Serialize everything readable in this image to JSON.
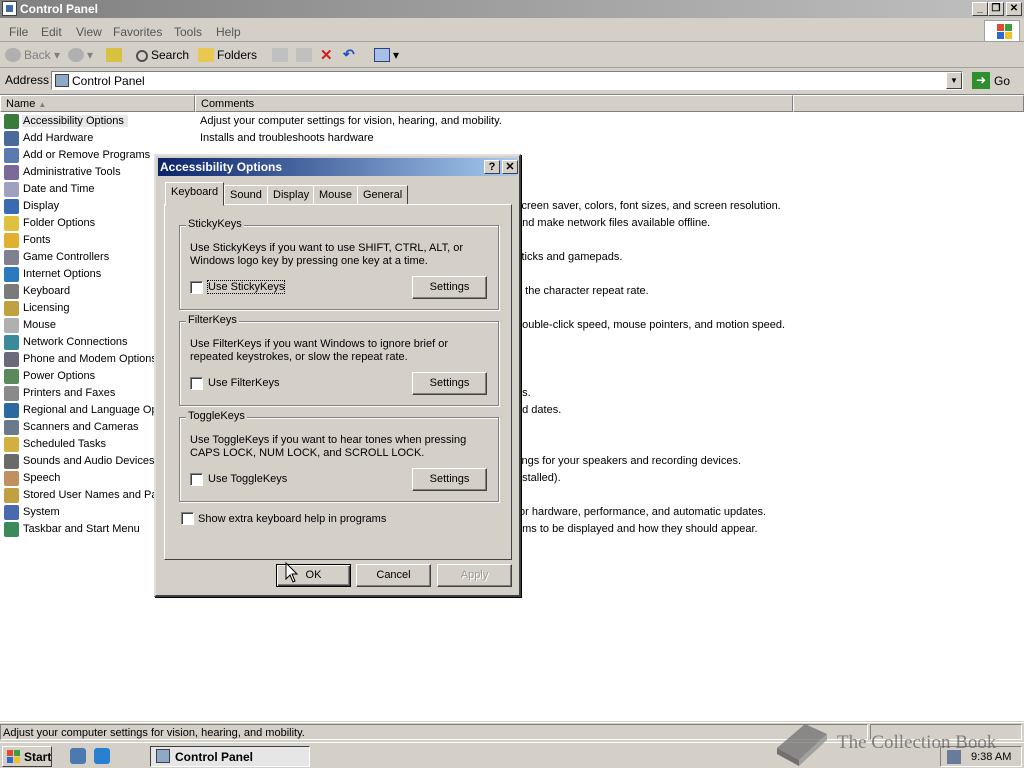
{
  "window": {
    "title": "Control Panel"
  },
  "menubar": [
    "File",
    "Edit",
    "View",
    "Favorites",
    "Tools",
    "Help"
  ],
  "toolbar": {
    "back": "Back",
    "search": "Search",
    "folders": "Folders"
  },
  "address": {
    "label": "Address",
    "value": "Control Panel",
    "go": "Go"
  },
  "columns": {
    "name": "Name",
    "comments": "Comments"
  },
  "items": [
    {
      "name": "Accessibility Options",
      "icon": "accessibility-icon",
      "color": "#3a7a3a"
    },
    {
      "name": "Add Hardware",
      "icon": "add-hardware-icon",
      "color": "#4a6a9a"
    },
    {
      "name": "Add or Remove Programs",
      "icon": "add-remove-programs-icon",
      "color": "#5a7ab0"
    },
    {
      "name": "Administrative Tools",
      "icon": "admin-tools-icon",
      "color": "#7a6a9a"
    },
    {
      "name": "Date and Time",
      "icon": "date-time-icon",
      "color": "#a0a0c0"
    },
    {
      "name": "Display",
      "icon": "display-icon",
      "color": "#3a6ab0"
    },
    {
      "name": "Folder Options",
      "icon": "folder-options-icon",
      "color": "#e0c040"
    },
    {
      "name": "Fonts",
      "icon": "fonts-icon",
      "color": "#e0b030"
    },
    {
      "name": "Game Controllers",
      "icon": "game-controllers-icon",
      "color": "#808090"
    },
    {
      "name": "Internet Options",
      "icon": "internet-options-icon",
      "color": "#2a7ac0"
    },
    {
      "name": "Keyboard",
      "icon": "keyboard-icon",
      "color": "#7a7a7a"
    },
    {
      "name": "Licensing",
      "icon": "licensing-icon",
      "color": "#c0a040"
    },
    {
      "name": "Mouse",
      "icon": "mouse-icon",
      "color": "#b0b0b0"
    },
    {
      "name": "Network Connections",
      "icon": "network-connections-icon",
      "color": "#3a8a9a"
    },
    {
      "name": "Phone and Modem Options",
      "icon": "phone-modem-icon",
      "color": "#6a6a7a"
    },
    {
      "name": "Power Options",
      "icon": "power-options-icon",
      "color": "#5a8a5a"
    },
    {
      "name": "Printers and Faxes",
      "icon": "printers-faxes-icon",
      "color": "#8a8a8a"
    },
    {
      "name": "Regional and Language Opt",
      "icon": "regional-language-icon",
      "color": "#2a6aa0"
    },
    {
      "name": "Scanners and Cameras",
      "icon": "scanners-cameras-icon",
      "color": "#6a7a8a"
    },
    {
      "name": "Scheduled Tasks",
      "icon": "scheduled-tasks-icon",
      "color": "#d0b040"
    },
    {
      "name": "Sounds and Audio Devices",
      "icon": "sounds-audio-icon",
      "color": "#6a6a6a"
    },
    {
      "name": "Speech",
      "icon": "speech-icon",
      "color": "#c09060"
    },
    {
      "name": "Stored User Names and Pas",
      "icon": "stored-user-names-icon",
      "color": "#c0a040"
    },
    {
      "name": "System",
      "icon": "system-icon",
      "color": "#4a6ab0"
    },
    {
      "name": "Taskbar and Start Menu",
      "icon": "taskbar-start-menu-icon",
      "color": "#3a8a5a"
    }
  ],
  "comments": [
    "Adjust your computer settings for vision, hearing, and mobility.",
    "Installs and troubleshoots hardware",
    "",
    "",
    "",
    "screen saver, colors, font sizes, and screen resolution.",
    "and make network files available offline.",
    "",
    "sticks and gamepads.",
    "",
    "d the character repeat rate.",
    "",
    "double-click speed, mouse pointers, and motion speed.",
    "",
    "",
    "",
    "es.",
    "nd dates.",
    "",
    "",
    "tings for your speakers and recording devices.",
    "nstalled).",
    "",
    "for hardware, performance, and automatic updates.",
    "ems to be displayed and how they should appear."
  ],
  "status": {
    "text": "Adjust your computer settings for vision, hearing, and mobility."
  },
  "taskbar": {
    "start": "Start",
    "task": "Control Panel",
    "clock": "9:38 AM"
  },
  "watermark": "The Collection Book",
  "dialog": {
    "title": "Accessibility Options",
    "help": "?",
    "close": "✕",
    "tabs": [
      "Keyboard",
      "Sound",
      "Display",
      "Mouse",
      "General"
    ],
    "stickykeys": {
      "title": "StickyKeys",
      "desc": "Use StickyKeys if you want to use SHIFT, CTRL, ALT, or Windows logo key by pressing one key at a time.",
      "checkbox": "Use StickyKeys",
      "checked": false,
      "settings": "Settings"
    },
    "filterkeys": {
      "title": "FilterKeys",
      "desc": "Use FilterKeys if you want Windows to ignore brief or repeated keystrokes, or slow the repeat rate.",
      "checkbox": "Use FilterKeys",
      "checked": false,
      "settings": "Settings"
    },
    "togglekeys": {
      "title": "ToggleKeys",
      "desc": "Use ToggleKeys if you want to hear tones when pressing CAPS LOCK, NUM LOCK, and SCROLL LOCK.",
      "checkbox": "Use ToggleKeys",
      "checked": false,
      "settings": "Settings"
    },
    "extrahelp": {
      "label": "Show extra keyboard help in programs",
      "checked": false
    },
    "ok": "OK",
    "cancel": "Cancel",
    "apply": "Apply"
  }
}
